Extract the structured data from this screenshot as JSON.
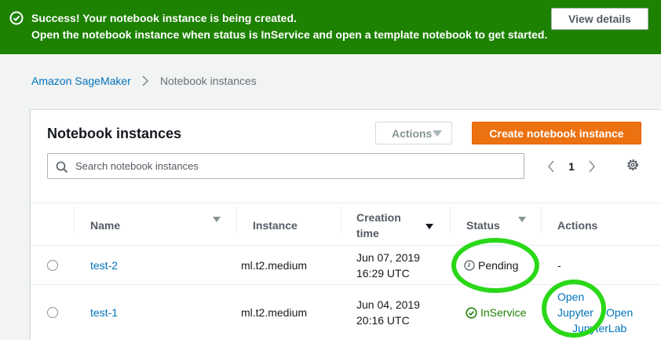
{
  "flash": {
    "title": "Success! Your notebook instance is being created.",
    "message": "Open the notebook instance when status is InService and open a template notebook to get started.",
    "button": "View details",
    "icon": "check-circle-icon"
  },
  "breadcrumb": {
    "parent": "Amazon SageMaker",
    "current": "Notebook instances"
  },
  "panel": {
    "title": "Notebook instances",
    "actions_label": "Actions",
    "create_label": "Create notebook instance",
    "search_placeholder": "Search notebook instances",
    "page": "1"
  },
  "table": {
    "headers": {
      "name": "Name",
      "instance": "Instance",
      "creation_line1": "Creation",
      "creation_line2": "time",
      "status": "Status",
      "actions": "Actions"
    },
    "rows": [
      {
        "name": "test-2",
        "instance": "ml.t2.medium",
        "date": "Jun 07, 2019",
        "time": "16:29 UTC",
        "status": "Pending",
        "status_icon": "clock-icon",
        "action": "-"
      },
      {
        "name": "test-1",
        "instance": "ml.t2.medium",
        "date": "Jun 04, 2019",
        "time": "20:16 UTC",
        "status": "InService",
        "status_icon": "check-circle-icon",
        "action_jupyter_line1": "Open",
        "action_jupyter_line2": "Jupyter",
        "action_lab_line1": "Open",
        "action_lab_line2": "JupyterLab"
      }
    ]
  },
  "colors": {
    "success_green": "#1d8102",
    "primary_orange": "#ec7211",
    "link_blue": "#0073bb",
    "annotation_green": "#2ad818"
  }
}
